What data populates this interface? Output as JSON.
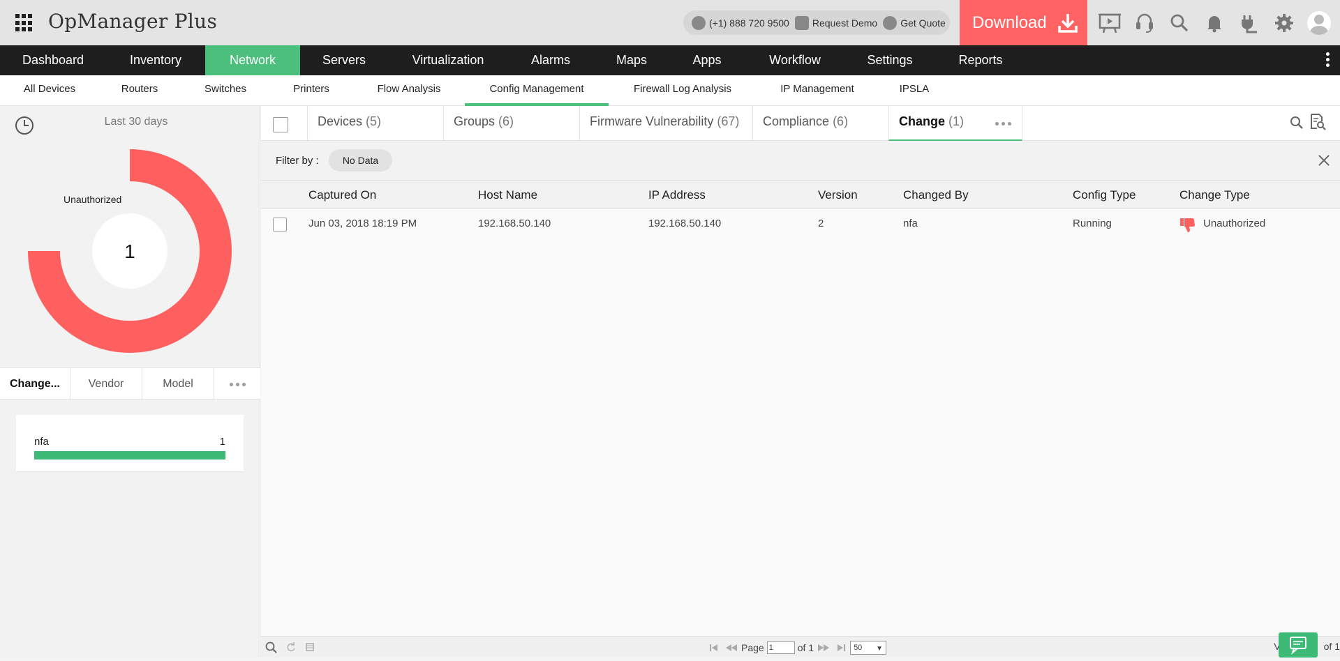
{
  "header": {
    "app_name": "OpManager Plus",
    "phone": "(+1) 888 720 9500",
    "request_demo": "Request Demo",
    "get_quote": "Get Quote",
    "download_label": "Download"
  },
  "main_nav": [
    {
      "label": "Dashboard",
      "active": false
    },
    {
      "label": "Inventory",
      "active": false
    },
    {
      "label": "Network",
      "active": true
    },
    {
      "label": "Servers",
      "active": false
    },
    {
      "label": "Virtualization",
      "active": false
    },
    {
      "label": "Alarms",
      "active": false
    },
    {
      "label": "Maps",
      "active": false
    },
    {
      "label": "Apps",
      "active": false
    },
    {
      "label": "Workflow",
      "active": false
    },
    {
      "label": "Settings",
      "active": false
    },
    {
      "label": "Reports",
      "active": false
    }
  ],
  "sub_nav": [
    {
      "label": "All Devices"
    },
    {
      "label": "Routers"
    },
    {
      "label": "Switches"
    },
    {
      "label": "Printers"
    },
    {
      "label": "Flow Analysis"
    },
    {
      "label": "Config Management",
      "active": true
    },
    {
      "label": "Firewall Log Analysis"
    },
    {
      "label": "IP Management"
    },
    {
      "label": "IPSLA"
    }
  ],
  "left_panel": {
    "period": "Last 30 days",
    "donut": {
      "center_value": "1",
      "label": "Unauthorized",
      "color": "#fe5f5f",
      "fraction": 0.75
    },
    "tabs": [
      {
        "label": "Change...",
        "active": true
      },
      {
        "label": "Vendor"
      },
      {
        "label": "Model"
      }
    ],
    "vendor_row": {
      "name": "nfa",
      "count": "1",
      "fill": 1.0
    }
  },
  "content_tabs": [
    {
      "label": "Devices",
      "count": "(5)"
    },
    {
      "label": "Groups",
      "count": "(6)"
    },
    {
      "label": "Firmware Vulnerability",
      "count": "(67)"
    },
    {
      "label": "Compliance",
      "count": "(6)"
    },
    {
      "label": "Change",
      "count": "(1)",
      "active": true
    }
  ],
  "filter": {
    "label": "Filter by :",
    "chip": "No Data"
  },
  "table": {
    "columns": [
      "Captured On",
      "Host Name",
      "IP Address",
      "Version",
      "Changed By",
      "Config Type",
      "Change Type"
    ],
    "rows": [
      [
        "Jun 03, 2018 18:19 PM",
        "192.168.50.140",
        "192.168.50.140",
        "2",
        "nfa",
        "Running",
        "Unauthorized"
      ]
    ]
  },
  "footer": {
    "page_label": "Page",
    "page_value": "1",
    "of_label": "of 1",
    "per_page": "50",
    "right_text": "of 1",
    "right_prefix": "V"
  },
  "colors": {
    "accent_green": "#4cbf7d",
    "download_red": "#ff6363",
    "donut_red": "#fe5f5f"
  }
}
